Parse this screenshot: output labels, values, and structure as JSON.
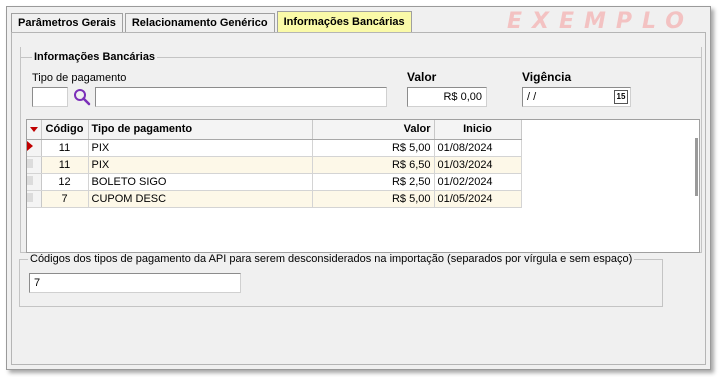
{
  "tabs": [
    {
      "label": "Parâmetros Gerais",
      "active": false
    },
    {
      "label": "Relacionamento Genérico",
      "active": false
    },
    {
      "label": "Informações Bancárias",
      "active": true
    }
  ],
  "watermark": "EXEMPLO",
  "group": {
    "title": "Informações Bancárias",
    "tipo_label": "Tipo de pagamento",
    "tipo_code_value": "",
    "tipo_desc_value": "",
    "valor_label": "Valor",
    "valor_value": "R$ 0,00",
    "vigencia_label": "Vigência",
    "vigencia_value": " /  /",
    "calendar_button": "15"
  },
  "grid": {
    "columns": [
      "Código",
      "Tipo de pagamento",
      "Valor",
      "Inicio"
    ],
    "rows": [
      {
        "codigo": "11",
        "tipo": "PIX",
        "valor": "R$ 5,00",
        "inicio": "01/08/2024"
      },
      {
        "codigo": "11",
        "tipo": "PIX",
        "valor": "R$ 6,50",
        "inicio": "01/03/2024"
      },
      {
        "codigo": "12",
        "tipo": "BOLETO SIGO",
        "valor": "R$ 2,50",
        "inicio": "01/02/2024"
      },
      {
        "codigo": "7",
        "tipo": "CUPOM DESC",
        "valor": "R$ 5,00",
        "inicio": "01/05/2024"
      }
    ]
  },
  "exclusion": {
    "title": "Códigos dos tipos de pagamento da API  para serem desconsiderados na importação (separados por vírgula e sem espaço)",
    "value": "7"
  },
  "colors": {
    "active_tab": "#fafaa8",
    "indicator": "#c00000",
    "row_cream": "#fdf8e8",
    "watermark": "#f3c2c2"
  }
}
